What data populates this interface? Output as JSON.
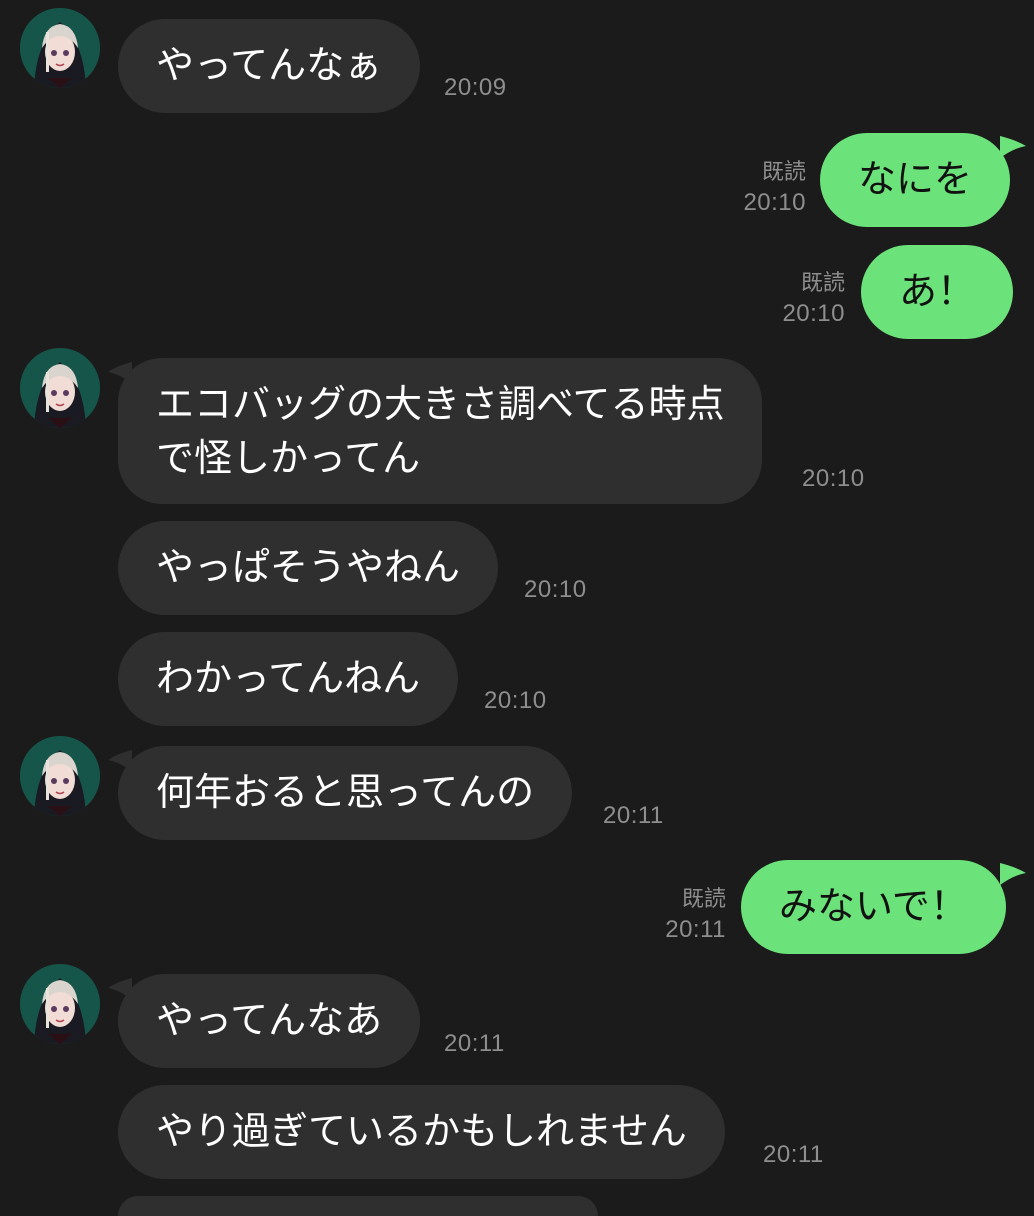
{
  "messages": [
    {
      "side": "in",
      "text": "やってんなぁ",
      "time": "20:09",
      "avatar": true
    },
    {
      "side": "out",
      "text": "なにを",
      "time": "20:10",
      "read": "既読"
    },
    {
      "side": "out",
      "text": "あ！",
      "time": "20:10",
      "read": "既読"
    },
    {
      "side": "in",
      "text": "エコバッグの大きさ調べてる時点\nで怪しかってん",
      "text_line1": "エコバッグの大きさ調べてる時点",
      "text_line2": "で怪しかってん",
      "time": "20:10",
      "avatar": true
    },
    {
      "side": "in",
      "text": "やっぱそうやねん",
      "time": "20:10"
    },
    {
      "side": "in",
      "text": "わかってんねん",
      "time": "20:10"
    },
    {
      "side": "in",
      "text": "何年おると思ってんの",
      "time": "20:11",
      "avatar": true
    },
    {
      "side": "out",
      "text": "みないで！",
      "time": "20:11",
      "read": "既読"
    },
    {
      "side": "in",
      "text": "やってんなあ",
      "time": "20:11",
      "avatar": true
    },
    {
      "side": "in",
      "text": "やり過ぎているかもしれません",
      "time": "20:11"
    }
  ],
  "colors": {
    "background": "#1b1b1b",
    "incoming_bubble": "#2f2f2f",
    "outgoing_bubble": "#6ce37a",
    "meta_text": "#8e8e8e",
    "avatar_ring": "#16564a"
  },
  "icons": {
    "avatar": "contact-avatar-icon"
  }
}
